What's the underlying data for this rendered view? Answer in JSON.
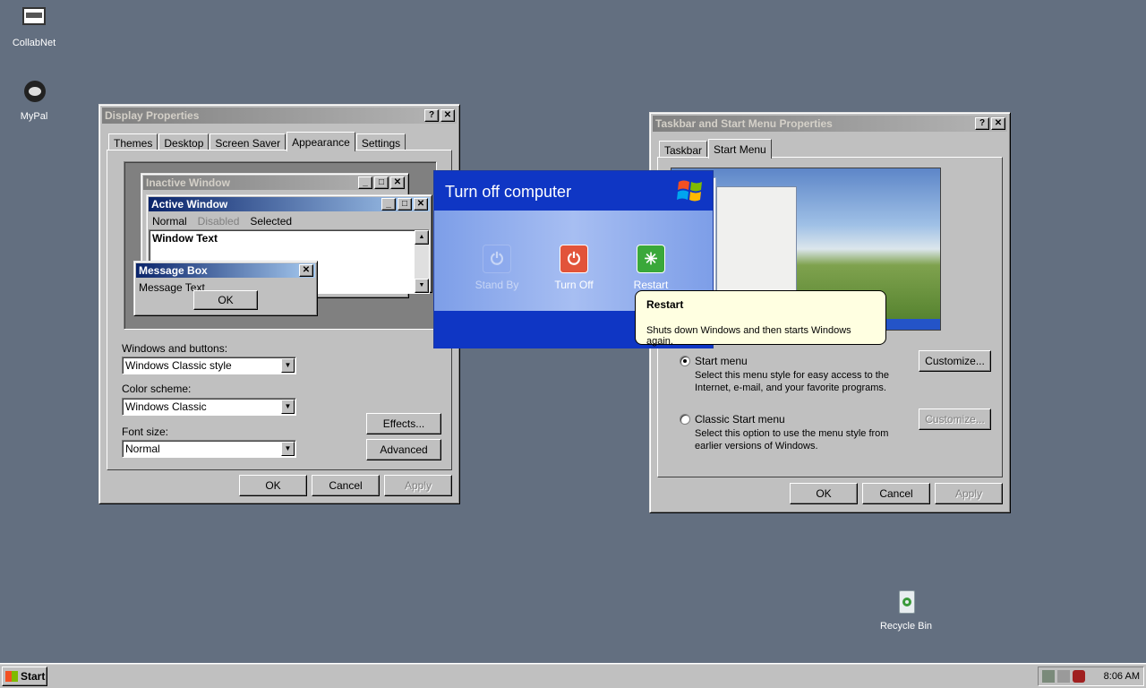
{
  "desktop": {
    "icons": [
      {
        "label": "CollabNet",
        "icon": "collabnet-icon"
      },
      {
        "label": "MyPal",
        "icon": "mypal-icon"
      },
      {
        "label": "Recycle Bin",
        "icon": "recycle-bin-icon"
      }
    ]
  },
  "display_props": {
    "title": "Display Properties",
    "tabs": [
      "Themes",
      "Desktop",
      "Screen Saver",
      "Appearance",
      "Settings"
    ],
    "selected_tab": "Appearance",
    "preview": {
      "inactive_title": "Inactive Window",
      "active_title": "Active Window",
      "menu": [
        "Normal",
        "Disabled",
        "Selected"
      ],
      "window_text": "Window Text",
      "msgbox_title": "Message Box",
      "msgbox_text": "Message Text",
      "msgbox_ok": "OK"
    },
    "windows_buttons_label": "Windows and buttons:",
    "windows_buttons_value": "Windows Classic style",
    "color_scheme_label": "Color scheme:",
    "color_scheme_value": "Windows Classic",
    "font_size_label": "Font size:",
    "font_size_value": "Normal",
    "effects": "Effects...",
    "advanced": "Advanced",
    "ok": "OK",
    "cancel": "Cancel",
    "apply": "Apply"
  },
  "turnoff": {
    "title": "Turn off computer",
    "options": [
      {
        "label": "Stand By",
        "enabled": false,
        "icon": "power-icon",
        "color": "#7d9ee8"
      },
      {
        "label": "Turn Off",
        "enabled": true,
        "icon": "power-icon",
        "color": "#e2543a"
      },
      {
        "label": "Restart",
        "enabled": true,
        "icon": "restart-icon",
        "color": "#3aa83a"
      }
    ]
  },
  "tooltip": {
    "title": "Restart",
    "text": "Shuts down Windows and then starts Windows again."
  },
  "taskbar_props": {
    "title": "Taskbar and Start Menu Properties",
    "tabs": [
      "Taskbar",
      "Start Menu"
    ],
    "selected_tab": "Start Menu",
    "start_menu_label": "Start menu",
    "start_menu_desc": "Select this menu style for easy access to the Internet, e-mail, and your favorite programs.",
    "classic_label": "Classic Start menu",
    "classic_desc": "Select this option to use the menu style from earlier versions of Windows.",
    "customize": "Customize...",
    "ok": "OK",
    "cancel": "Cancel",
    "apply": "Apply"
  },
  "taskbar": {
    "start_label": "Start",
    "clock": "8:06 AM"
  }
}
